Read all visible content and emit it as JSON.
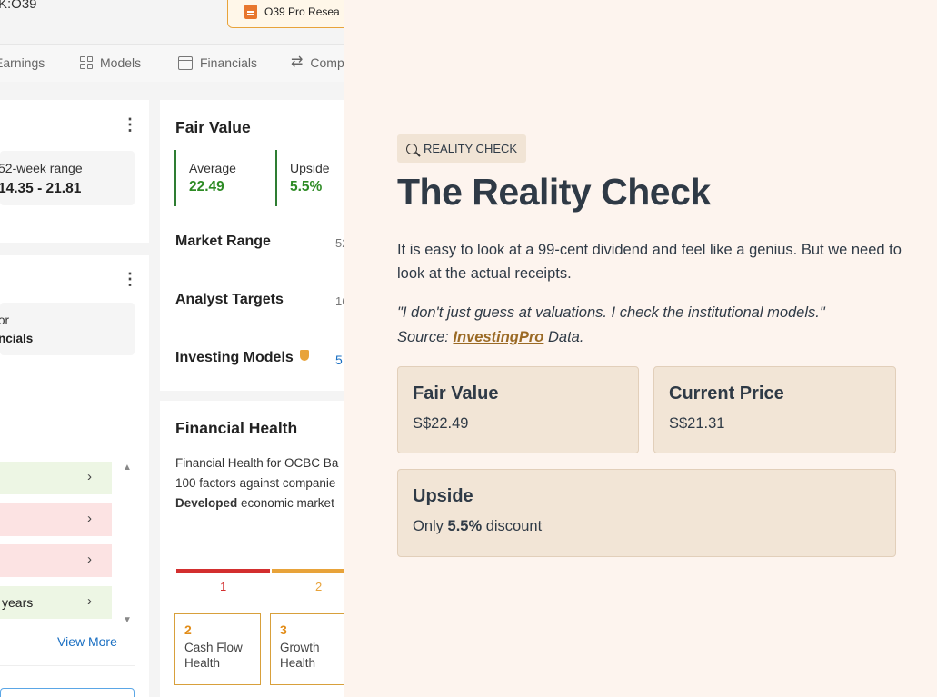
{
  "screenshot": {
    "ticker": "K:O39",
    "pro_button": "O39 Pro Resea",
    "tabs": [
      {
        "label": "Earnings"
      },
      {
        "label": "Models"
      },
      {
        "label": "Financials"
      },
      {
        "label": "Comp"
      }
    ],
    "range_card": {
      "label": "52-week range",
      "value": "14.35 - 21.81"
    },
    "second_card": {
      "line1": "or",
      "line2": "ncials"
    },
    "list_rows": [
      {
        "text": "",
        "tone": "green"
      },
      {
        "text": "",
        "tone": "red"
      },
      {
        "text": "",
        "tone": "red"
      },
      {
        "text": "years",
        "tone": "green"
      }
    ],
    "view_more": "View More",
    "fair_value": {
      "title": "Fair Value",
      "average_label": "Average",
      "average_value": "22.49",
      "upside_label": "Upside",
      "upside_value": "5.5%",
      "market_range_label": "Market Range",
      "market_range_value": "52",
      "analyst_targets_label": "Analyst Targets",
      "analyst_targets_value": "16",
      "models_label": "Investing Models",
      "models_value": "5"
    },
    "financial_health": {
      "title": "Financial Health",
      "line1": "Financial Health for OCBC Ba",
      "line2": "100 factors against companie",
      "line3_bold": "Developed",
      "line3_rest": " economic market",
      "score1": "1",
      "score2": "2",
      "boxes": [
        {
          "num": "2",
          "line1": "Cash Flow",
          "line2": "Health"
        },
        {
          "num": "3",
          "line1": "Growth",
          "line2": "Health"
        }
      ]
    },
    "chevron": "›"
  },
  "article": {
    "badge": "REALITY CHECK",
    "title": "The Reality Check",
    "paragraph": "It is easy to look at a 99-cent dividend and feel like a genius. But we need to look at the actual receipts.",
    "quote": "\"I don't just guess at valuations. I check the institutional models.\"",
    "source_prefix": "Source: ",
    "source_link": "InvestingPro",
    "source_suffix": " Data.",
    "cards": {
      "fair_value": {
        "title": "Fair Value",
        "value": "S$22.49"
      },
      "current_price": {
        "title": "Current Price",
        "value": "S$21.31"
      },
      "upside": {
        "title": "Upside",
        "prefix": "Only ",
        "bold": "5.5%",
        "suffix": " discount"
      }
    }
  },
  "colors": {
    "accent_brown": "#9b6a25",
    "positive_green": "#2e8b25",
    "card_beige": "#f2e5d6",
    "page_cream": "#fdf4ee"
  }
}
